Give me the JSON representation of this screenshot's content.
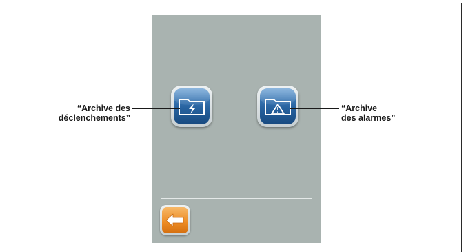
{
  "callouts": {
    "left_line1": "“Archive des",
    "left_line2": "déclenchements”",
    "right_line1": "“Archive",
    "right_line2": "des alarmes”"
  },
  "icons": {
    "trip_archive": "folder-lightning-icon",
    "alarm_archive": "folder-warning-icon",
    "back": "arrow-left-icon"
  },
  "colors": {
    "screen_background": "#a9b3b0",
    "button_blue": "#27629f",
    "back_orange": "#ec8a22"
  }
}
